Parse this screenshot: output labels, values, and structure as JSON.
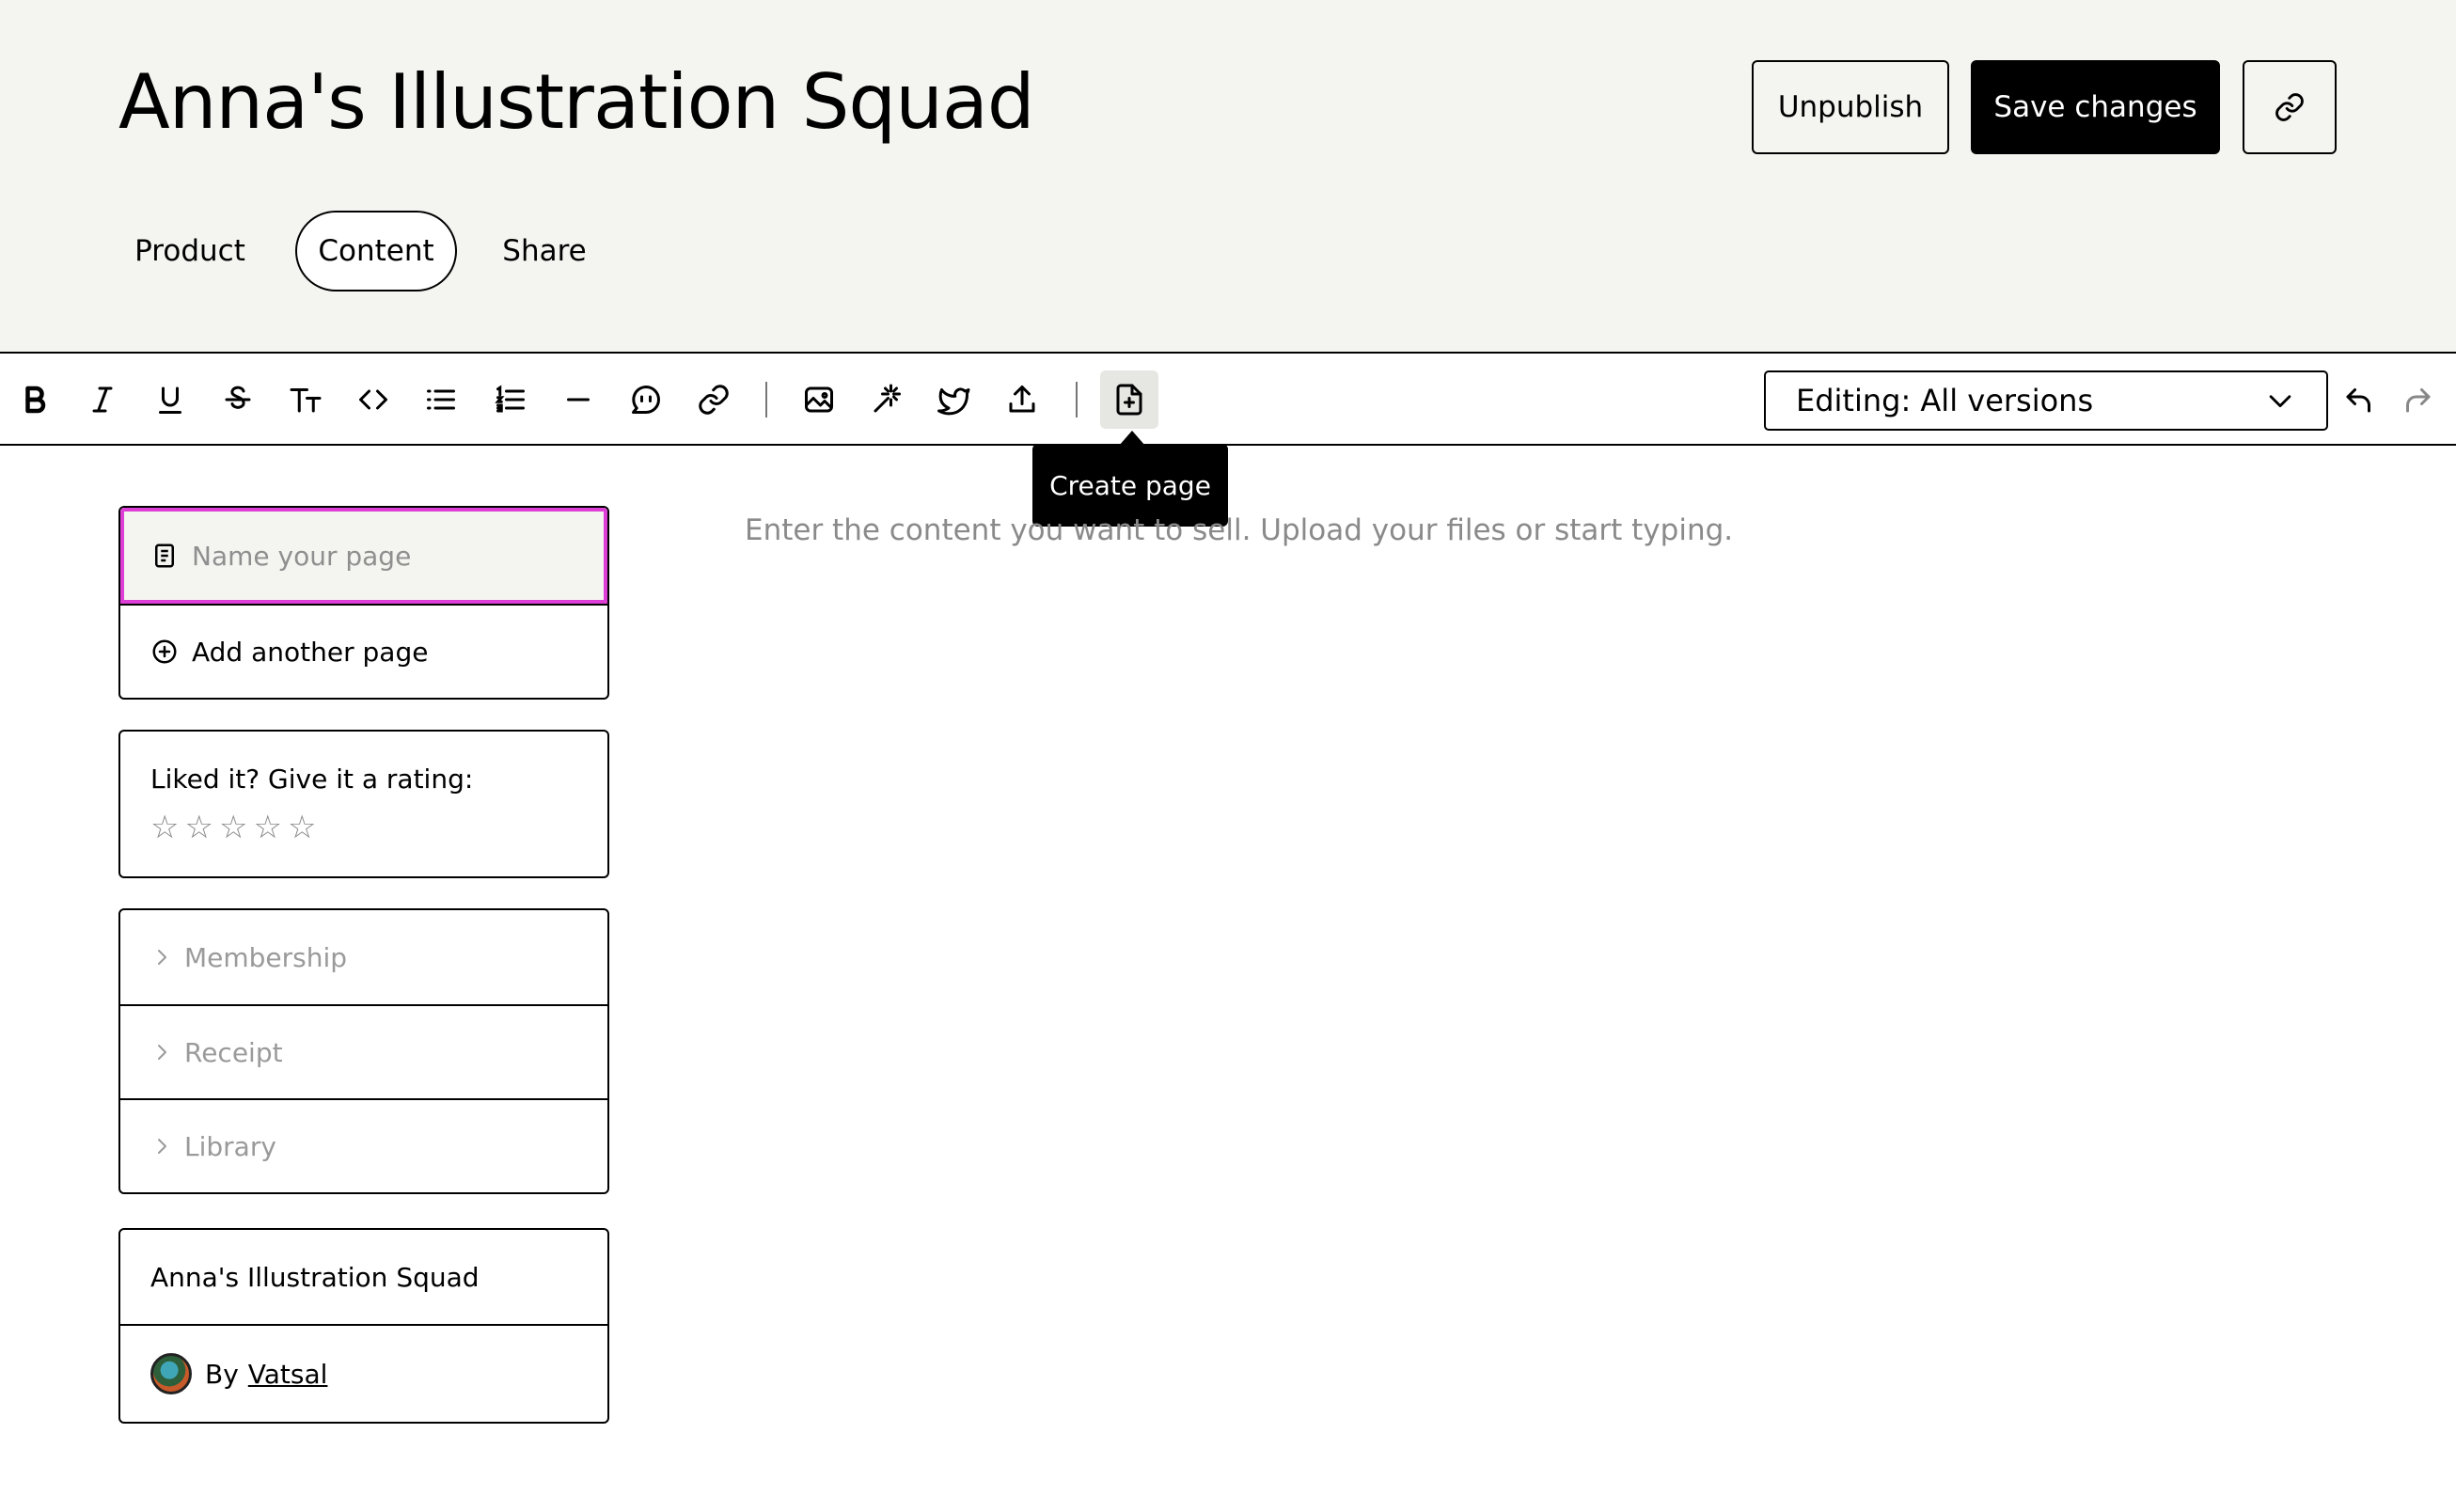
{
  "header": {
    "title": "Anna's Illustration Squad",
    "unpublish_label": "Unpublish",
    "save_label": "Save changes"
  },
  "tabs": [
    {
      "label": "Product",
      "active": false
    },
    {
      "label": "Content",
      "active": true
    },
    {
      "label": "Share",
      "active": false
    }
  ],
  "toolbar": {
    "icons": [
      "bold-icon",
      "italic-icon",
      "underline-icon",
      "strikethrough-icon",
      "text-size-icon",
      "code-icon",
      "bullet-list-icon",
      "numbered-list-icon",
      "horizontal-rule-icon",
      "quote-icon",
      "link-icon",
      "image-icon",
      "magic-embed-icon",
      "twitter-icon",
      "upload-icon",
      "create-page-icon"
    ],
    "active_icon": "create-page-icon",
    "tooltip": "Create page",
    "version_select": "Editing: All versions"
  },
  "pages": {
    "name_placeholder": "Name your page",
    "add_label": "Add another page"
  },
  "rating": {
    "prompt": "Liked it? Give it a rating:",
    "stars": 5,
    "value": 0
  },
  "sections": [
    {
      "label": "Membership"
    },
    {
      "label": "Receipt"
    },
    {
      "label": "Library"
    }
  ],
  "author": {
    "product_name": "Anna's Illustration Squad",
    "by_label": "By",
    "name": "Vatsal"
  },
  "editor": {
    "placeholder": "Enter the content you want to sell. Upload your files or start typing."
  },
  "colors": {
    "header_bg": "#f4f4f0",
    "focus_outline": "#dd3fd6",
    "primary_button": "#000000"
  }
}
